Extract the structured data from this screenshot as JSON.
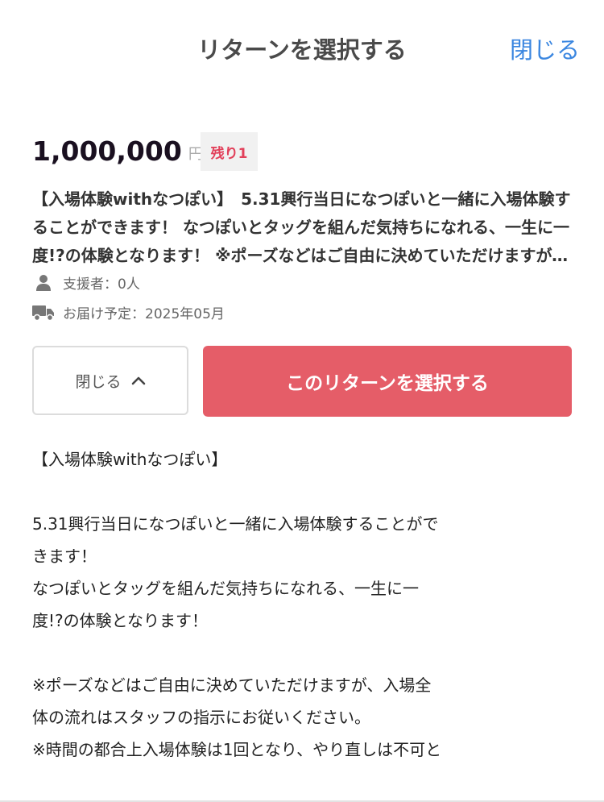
{
  "header": {
    "title": "リターンを選択する",
    "close_label": "閉じる"
  },
  "reward": {
    "price": "1,000,000",
    "currency": "円",
    "remaining": "残り1",
    "title": "【入場体験withなつぽい】　5.31興行当日になつぽいと一緒に入場体験することができます！ なつぽいとタッグを組んだ気持ちになれる、一生に一度!?の体験となります！ ※ポーズなどはご自由に決めていただけますが、入場全体の流れはスタッフの指示にお従いください。",
    "supporters": "支援者：0人",
    "delivery": "お届け予定：2025年05月"
  },
  "buttons": {
    "collapse_label": "閉じる",
    "select_label": "このリターンを選択する"
  },
  "description": {
    "heading": "【入場体験withなつぽい】",
    "lines": [
      "5.31興行当日になつぽいと一緒に入場体験することがで",
      "きます！",
      "なつぽいとタッグを組んだ気持ちになれる、一生に一",
      "度!?の体験となります！",
      "※ポーズなどはご自由に決めていただけますが、入場全",
      "体の流れはスタッフの指示にお従いください。",
      "※時間の都合上入場体験は1回となり、やり直しは不可と"
    ]
  },
  "icons": {
    "supporters": "person-icon",
    "delivery": "truck-icon",
    "collapse": "chevron-up-icon"
  },
  "colors": {
    "accent_link": "#3a86e0",
    "select_button": "#e55d68",
    "remaining_text": "#e2405a"
  }
}
